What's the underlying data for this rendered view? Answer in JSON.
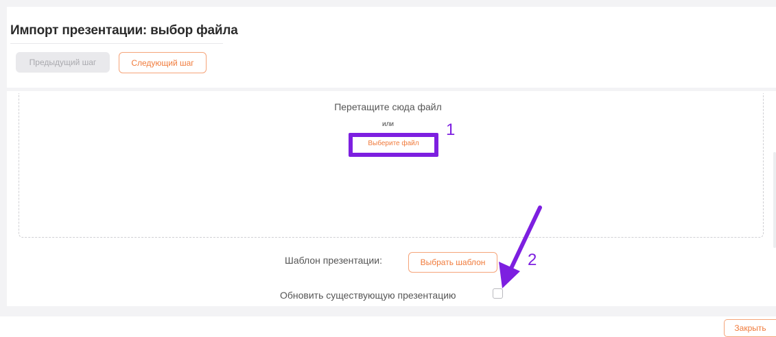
{
  "header": {
    "title": "Импорт презентации: выбор файла",
    "prev_label": "Предыдущий шаг",
    "next_label": "Следующий шаг"
  },
  "dropzone": {
    "drag_text": "Перетащите сюда файл",
    "or_text": "или",
    "choose_file_label": "Выберите файл"
  },
  "annotations": {
    "marker_1": "1",
    "marker_2": "2"
  },
  "template": {
    "label": "Шаблон презентации:",
    "button_label": "Выбрать шаблон"
  },
  "update": {
    "label": "Обновить существующую презентацию",
    "checked": false
  },
  "footer": {
    "close_label": "Закрыть"
  },
  "colors": {
    "accent": "#f07a3a",
    "annotation": "#7d1fe0",
    "disabled_bg": "#e9e9ec"
  }
}
